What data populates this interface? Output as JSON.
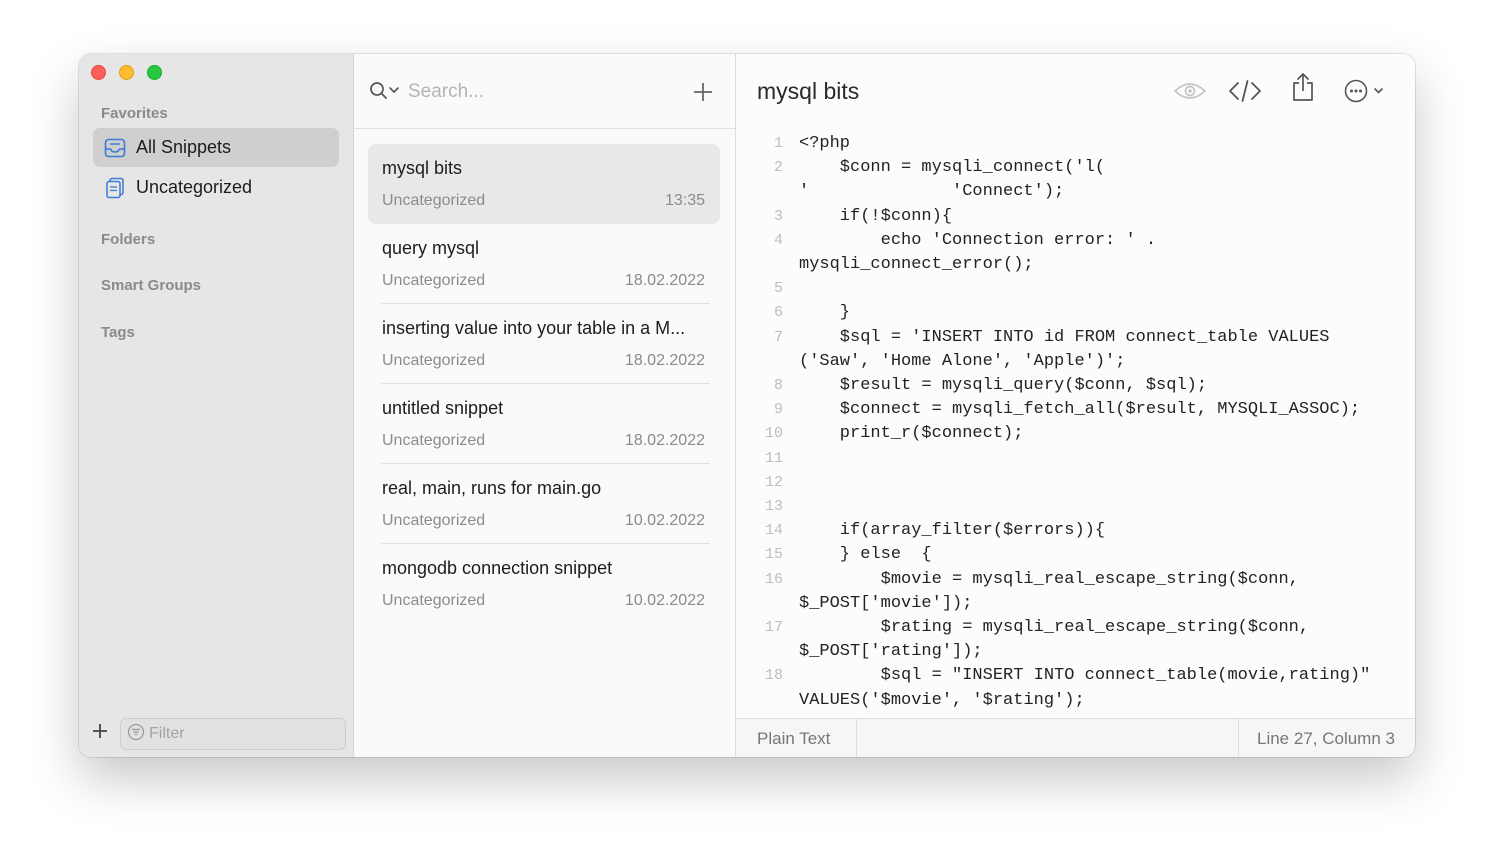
{
  "colors": {
    "sidebar_bg": "#e6e6e6",
    "accent": "#3a7bd5",
    "traffic_close": "#fe5f57",
    "traffic_min": "#febc2e",
    "traffic_max": "#28c840"
  },
  "sidebar": {
    "favorites_label": "Favorites",
    "items": [
      {
        "label": "All Snippets",
        "icon": "tray-icon",
        "selected": true
      },
      {
        "label": "Uncategorized",
        "icon": "document-icon",
        "selected": false
      }
    ],
    "folders_label": "Folders",
    "smart_groups_label": "Smart Groups",
    "tags_label": "Tags",
    "filter_placeholder": "Filter"
  },
  "list": {
    "search_placeholder": "Search...",
    "snippets": [
      {
        "title": "mysql bits",
        "category": "Uncategorized",
        "date": "13:35",
        "selected": true
      },
      {
        "title": "query mysql",
        "category": "Uncategorized",
        "date": "18.02.2022"
      },
      {
        "title": "inserting value into your table in a M...",
        "category": "Uncategorized",
        "date": "18.02.2022"
      },
      {
        "title": "untitled snippet",
        "category": "Uncategorized",
        "date": "18.02.2022"
      },
      {
        "title": "real, main, runs for main.go",
        "category": "Uncategorized",
        "date": "10.02.2022"
      },
      {
        "title": "mongodb connection snippet",
        "category": "Uncategorized",
        "date": "10.02.2022"
      }
    ]
  },
  "editor": {
    "title": "mysql bits",
    "lines": [
      {
        "n": "1",
        "text": "<?php"
      },
      {
        "n": "2",
        "text": "    $conn = mysqli_connect('l("
      },
      {
        "n": "",
        "text": "'              'Connect');"
      },
      {
        "n": "3",
        "text": "    if(!$conn){"
      },
      {
        "n": "4",
        "text": "        echo 'Connection error: ' ."
      },
      {
        "n": "",
        "text": "mysqli_connect_error();"
      },
      {
        "n": "5",
        "text": ""
      },
      {
        "n": "6",
        "text": "    }"
      },
      {
        "n": "7",
        "text": "    $sql = 'INSERT INTO id FROM connect_table VALUES"
      },
      {
        "n": "",
        "text": "('Saw', 'Home Alone', 'Apple')';"
      },
      {
        "n": "8",
        "text": "    $result = mysqli_query($conn, $sql);"
      },
      {
        "n": "9",
        "text": "    $connect = mysqli_fetch_all($result, MYSQLI_ASSOC);"
      },
      {
        "n": "10",
        "text": "    print_r($connect);"
      },
      {
        "n": "11",
        "text": ""
      },
      {
        "n": "12",
        "text": ""
      },
      {
        "n": "13",
        "text": ""
      },
      {
        "n": "14",
        "text": "    if(array_filter($errors)){"
      },
      {
        "n": "15",
        "text": "    } else  {"
      },
      {
        "n": "16",
        "text": "        $movie = mysqli_real_escape_string($conn,"
      },
      {
        "n": "",
        "text": "$_POST['movie']);"
      },
      {
        "n": "17",
        "text": "        $rating = mysqli_real_escape_string($conn,"
      },
      {
        "n": "",
        "text": "$_POST['rating']);"
      },
      {
        "n": "18",
        "text": "        $sql = \"INSERT INTO connect_table(movie,rating)\""
      },
      {
        "n": "",
        "text": "VALUES('$movie', '$rating');"
      }
    ],
    "status_language": "Plain Text",
    "status_position": "Line 27, Column 3"
  }
}
